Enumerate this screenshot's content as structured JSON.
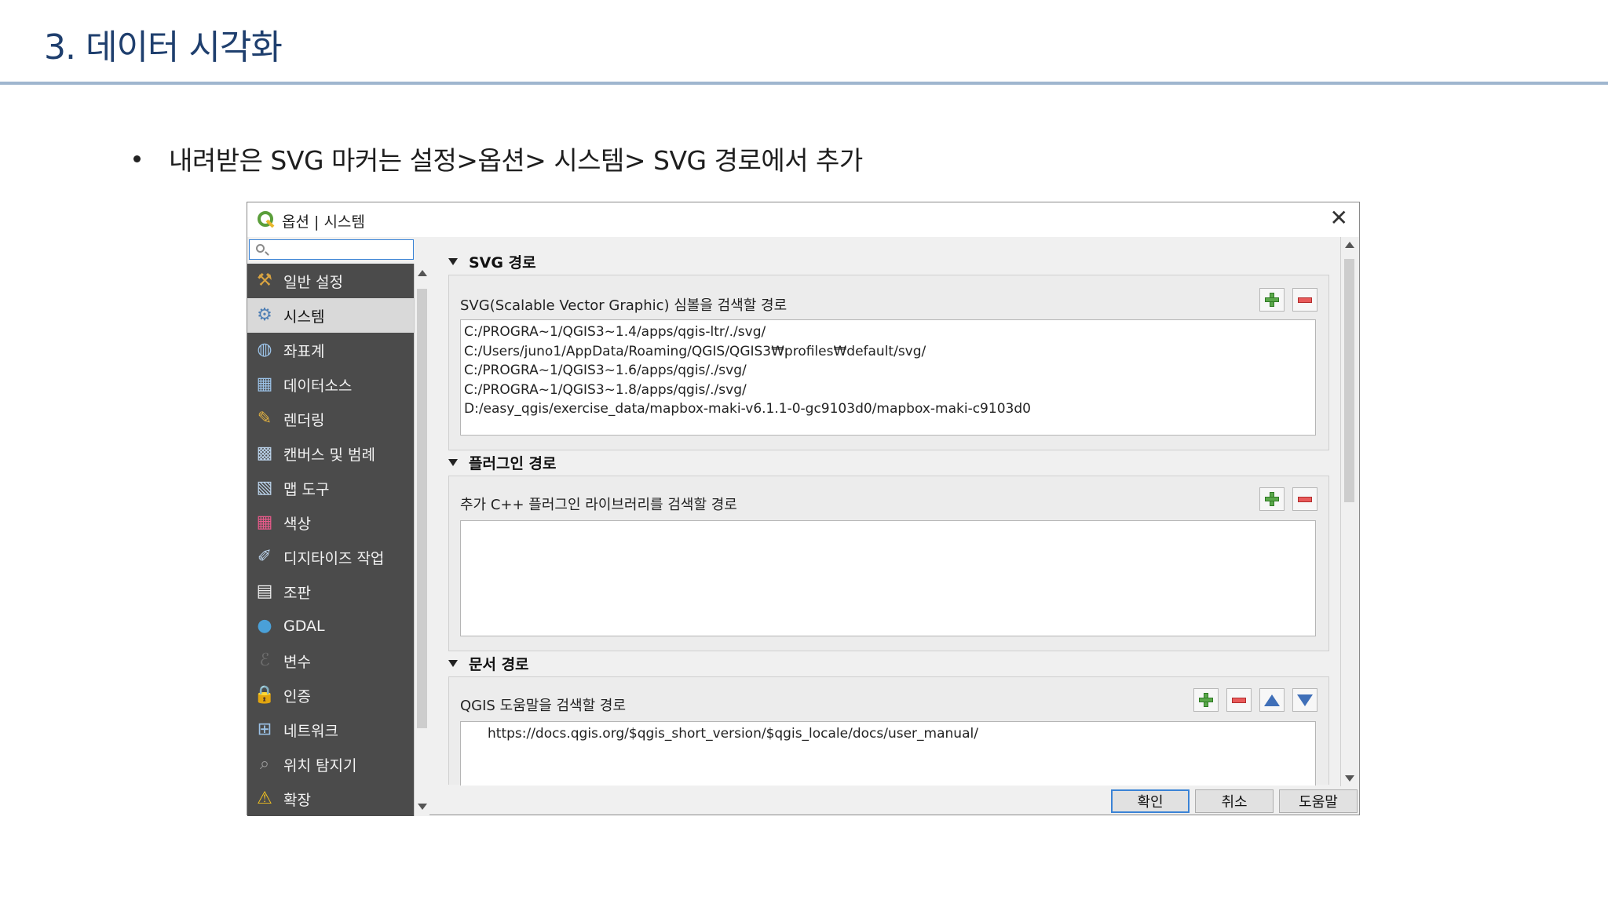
{
  "slide": {
    "title": "3. 데이터 시각화",
    "bullet": "내려받은 SVG 마커는 설정>옵션> 시스템> SVG 경로에서 추가"
  },
  "dialog": {
    "title": "옵션 | 시스템",
    "search_value": "",
    "sidebar": [
      {
        "label": "일반 설정",
        "icon": "wrench-hammer-icon"
      },
      {
        "label": "시스템",
        "icon": "gears-icon",
        "selected": true
      },
      {
        "label": "좌표계",
        "icon": "globe-icon"
      },
      {
        "label": "데이터소스",
        "icon": "table-icon"
      },
      {
        "label": "렌더링",
        "icon": "paintbrush-icon"
      },
      {
        "label": "캔버스 및 범례",
        "icon": "map-canvas-icon"
      },
      {
        "label": "맵 도구",
        "icon": "map-tools-icon"
      },
      {
        "label": "색상",
        "icon": "color-grid-icon"
      },
      {
        "label": "디지타이즈 작업",
        "icon": "digitize-icon"
      },
      {
        "label": "조판",
        "icon": "layout-icon"
      },
      {
        "label": "GDAL",
        "icon": "gdal-globe-icon"
      },
      {
        "label": "변수",
        "icon": "variable-icon"
      },
      {
        "label": "인증",
        "icon": "lock-icon"
      },
      {
        "label": "네트워크",
        "icon": "network-icon"
      },
      {
        "label": "위치 탐지기",
        "icon": "search-icon"
      },
      {
        "label": "확장",
        "icon": "warning-icon"
      }
    ],
    "sections": {
      "svg": {
        "header": "SVG 경로",
        "label": "SVG(Scalable Vector Graphic) 심볼을 검색할 경로",
        "paths": [
          "C:/PROGRA~1/QGIS3~1.4/apps/qgis-ltr/./svg/",
          "C:/Users/juno1/AppData/Roaming/QGIS/QGIS3₩profiles₩default/svg/",
          "C:/PROGRA~1/QGIS3~1.6/apps/qgis/./svg/",
          "C:/PROGRA~1/QGIS3~1.8/apps/qgis/./svg/",
          "D:/easy_qgis/exercise_data/mapbox-maki-v6.1.1-0-gc9103d0/mapbox-maki-c9103d0"
        ]
      },
      "plugin": {
        "header": "플러그인 경로",
        "label": "추가 C++ 플러그인 라이브러리를 검색할 경로",
        "paths": []
      },
      "docs": {
        "header": "문서 경로",
        "label": "QGIS 도움말을 검색할 경로",
        "paths": [
          "https://docs.qgis.org/$qgis_short_version/$qgis_locale/docs/user_manual/"
        ]
      }
    },
    "buttons": {
      "ok": "확인",
      "cancel": "취소",
      "help": "도움말"
    }
  }
}
